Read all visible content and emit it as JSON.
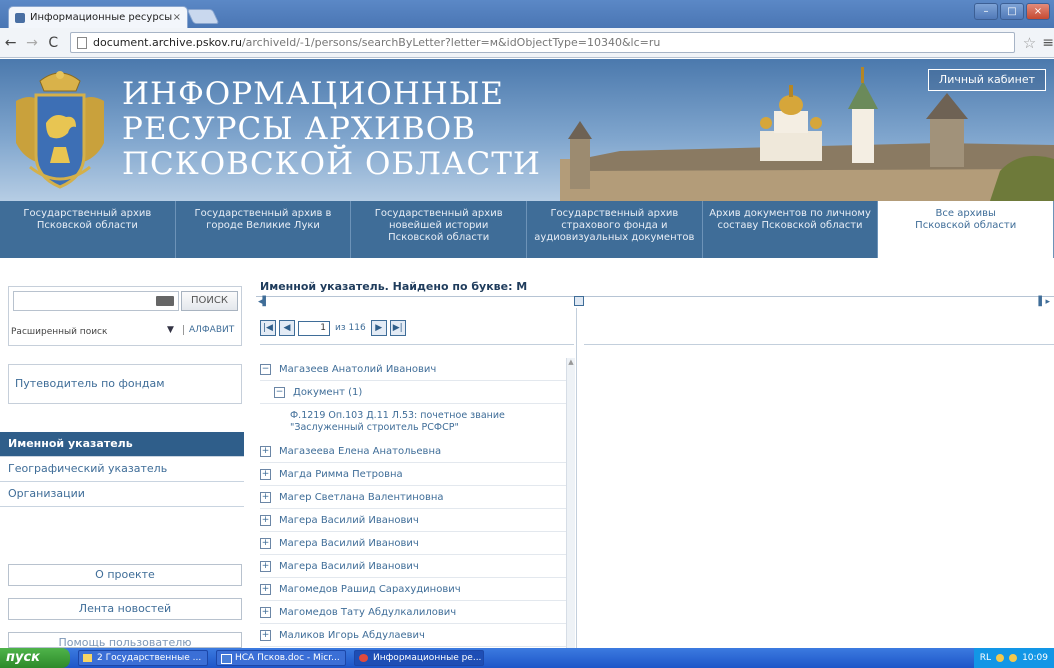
{
  "browser": {
    "tab_title": "Информационные ресурсы",
    "tab_close": "×",
    "url_host": "document.archive.pskov.ru",
    "url_path": "/archiveId/-1/persons/searchByLetter?letter=м&idObjectType=10340&lc=ru",
    "nav_back": "←",
    "nav_forward": "→",
    "nav_reload": "C",
    "star": "☆",
    "menu": "≡"
  },
  "header": {
    "title_lines": [
      "ИНФОРМАЦИОННЫЕ",
      "РЕСУРСЫ  АРХИВОВ",
      "ПСКОВСКОЙ  ОБЛАСТИ"
    ],
    "cabinet": "Личный кабинет"
  },
  "archive_nav": [
    "Государственный архив\nПсковской области",
    "Государственный архив в\nгороде Великие Луки",
    "Государственный архив\nновейшей истории\nПсковской области",
    "Государственный архив\nстрахового фонда и\nаудиовизуальных документов",
    "Архив документов по личному\nсоставу Псковской области",
    "Все архивы\nПсковской области"
  ],
  "search": {
    "button": "ПОИСК",
    "advanced": "Расширенный поиск",
    "alphabet": "АЛФАВИТ"
  },
  "sidebar": {
    "guide": "Путеводитель по фондам",
    "index_items": [
      "Именной указатель",
      "Географический указатель",
      "Организации"
    ],
    "about": "О проекте",
    "news": "Лента новостей",
    "help": "Помощь пользователю"
  },
  "main": {
    "title": "Именной указатель. Найдено по букве: М",
    "page": "1",
    "of_total": "из 116",
    "tree": [
      {
        "type": "person",
        "expanded": true,
        "label": "Магазеев Анатолий Иванович"
      },
      {
        "type": "group",
        "label": "Документ (1)"
      },
      {
        "type": "doc",
        "label": "Ф.1219 Оп.103 Д.11 Л.53: почетное звание \"Заслуженный строитель РСФСР\""
      },
      {
        "type": "person",
        "label": "Магазеева Елена Анатольевна"
      },
      {
        "type": "person",
        "label": "Магда Римма Петровна"
      },
      {
        "type": "person",
        "label": "Магер Светлана Валентиновна"
      },
      {
        "type": "person",
        "label": "Магера Василий Иванович"
      },
      {
        "type": "person",
        "label": "Магера Василий Иванович"
      },
      {
        "type": "person",
        "label": "Магера Василий Иванович"
      },
      {
        "type": "person",
        "label": "Магомедов Рашид Сарахудинович"
      },
      {
        "type": "person",
        "label": "Магомедов Тату Абдулкалилович"
      },
      {
        "type": "person",
        "label": "Маликов Игорь Абдулаевич"
      }
    ]
  },
  "taskbar": {
    "start": "пуск",
    "tasks": [
      "2 Государственные ...",
      "НСА Псков.doc - Micr...",
      "Информационные ре..."
    ],
    "lang": "RL",
    "clock": "10:09"
  }
}
